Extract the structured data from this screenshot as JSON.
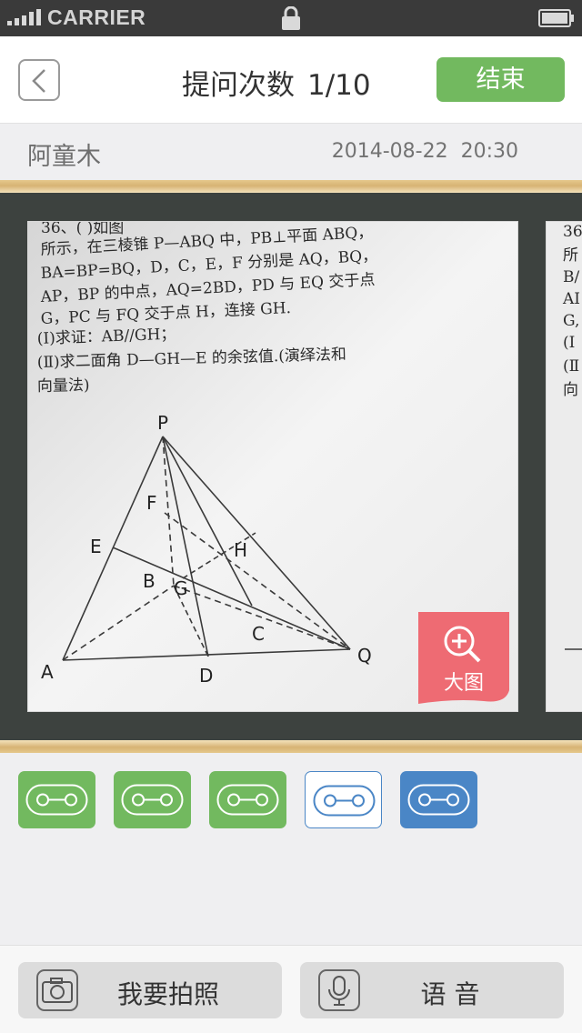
{
  "status_bar": {
    "carrier": "CARRIER"
  },
  "nav": {
    "title": "提问次数",
    "question_counter": "1/10",
    "end_button": "结束"
  },
  "info": {
    "student_name": "阿童木",
    "date": "2014-08-22",
    "time": "20:30"
  },
  "photo": {
    "zoom_label": "大图",
    "text_lines": [
      "36、(          )如图",
      "所示，在三棱锥 P—ABQ 中，PB⊥平面 ABQ，",
      "BA=BP=BQ，D，C，E，F 分别是 AQ，BQ，",
      "AP，BP 的中点，AQ=2BD，PD 与 EQ 交于点",
      "G，PC 与 FQ 交于点 H，连接 GH.",
      "(Ⅰ)求证：AB//GH；",
      "(Ⅱ)求二面角 D—GH—E 的余弦值.(演绎法和",
      "向量法)"
    ],
    "figure_labels": {
      "P": "P",
      "F": "F",
      "E": "E",
      "H": "H",
      "B": "B",
      "G": "G",
      "C": "C",
      "A": "A",
      "D": "D",
      "Q": "Q"
    },
    "next_text_lines": [
      "36",
      "所",
      "B/",
      "AI",
      "G,",
      "(Ⅰ",
      "(Ⅱ",
      "向"
    ]
  },
  "thumbnails": [
    {
      "style": "green"
    },
    {
      "style": "green"
    },
    {
      "style": "green"
    },
    {
      "style": "outline"
    },
    {
      "style": "blue"
    }
  ],
  "bottom": {
    "photo_button": "我要拍照",
    "voice_button": "语 音"
  },
  "colors": {
    "accent_green": "#72b95f",
    "accent_blue": "#4a86c6",
    "zoom_red": "#ee6b73",
    "board": "#3d423f",
    "frame": "#d7b374"
  },
  "icons": {
    "back": "chevron-left-icon",
    "zoom": "zoom-in-icon",
    "thumb": "cassette-icon",
    "camera": "camera-icon",
    "mic": "microphone-icon",
    "lock": "lock-icon",
    "battery": "battery-icon",
    "signal": "signal-icon"
  }
}
